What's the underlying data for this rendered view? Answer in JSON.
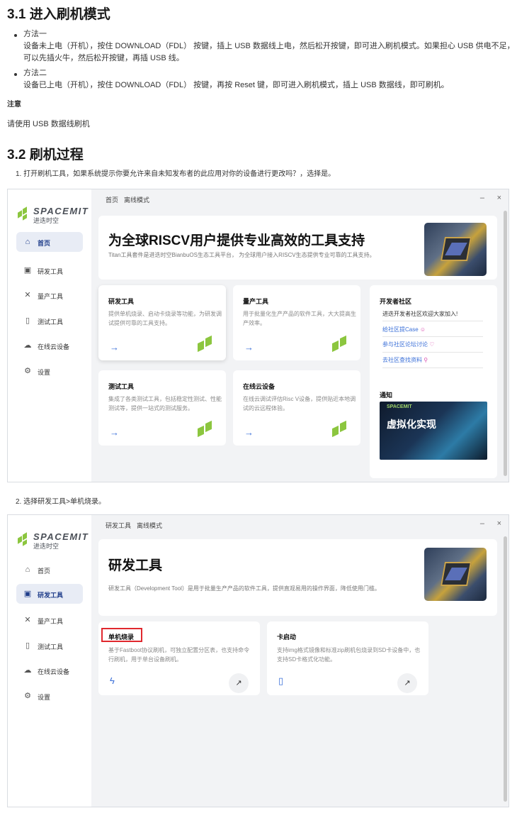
{
  "section1": {
    "heading": "3.1 进入刷机模式",
    "bullets": [
      {
        "title": "方法一",
        "lines": [
          "设备未上电（开机），按住 DOWNLOAD（FDL） 按键，插上 USB 数据线上电，然后松开按键，即可进入刷机模式。如果担心 USB 供电不足，",
          "可以先插火牛，然后松开按键，再插 USB 线。"
        ]
      },
      {
        "title": "方法二",
        "lines": [
          "设备已上电（开机），按住 DOWNLOAD（FDL） 按键，再按 Reset 键，即可进入刷机模式，插上 USB 数据线，即可刷机。"
        ]
      }
    ],
    "note_label": "注意",
    "note_text": "请使用 USB 数据线刷机"
  },
  "section2": {
    "heading": "3.2 刷机过程",
    "step1": "1. 打开刷机工具，如果系统提示你要允许来自未知发布者的此应用对你的设备进行更改吗？，选择是。",
    "step2": "2. 选择研发工具>单机烧录。"
  },
  "app": {
    "logo_text": "SPACEMIT",
    "logo_sub": "进迭时空",
    "nav": [
      {
        "label": "首页",
        "icon": "home-icon"
      },
      {
        "label": "研发工具",
        "icon": "dev-tool-icon"
      },
      {
        "label": "量产工具",
        "icon": "tools-icon"
      },
      {
        "label": "测试工具",
        "icon": "test-tube-icon"
      },
      {
        "label": "在线云设备",
        "icon": "cloud-icon"
      },
      {
        "label": "设置",
        "icon": "gear-icon"
      }
    ],
    "breadcrumb_home": "首页",
    "breadcrumb_dev": "研发工具",
    "breadcrumb_mode": "离线模式",
    "minimize": "–",
    "close": "×"
  },
  "shot1": {
    "banner_title": "为全球RISCV用户提供专业高效的工具支持",
    "banner_desc": "Titan工具套件是进迭时空BianbuOS生态工具平台， 为全球用户接入RISCV生态提供专业可靠的工具支持。",
    "cards": [
      {
        "title": "研发工具",
        "desc": "提供单机烧录、启动卡烧录等功能，为研发调试提供可靠的工具支持。"
      },
      {
        "title": "量产工具",
        "desc": "用于批量化生产产品的软件工具，大大提高生产效率。"
      },
      {
        "title": "测试工具",
        "desc": "集成了各类测试工具，包括稳定性测试、性能测试等，提供一站式的测试服务。"
      },
      {
        "title": "在线云设备",
        "desc": "在线云调试评估Risc V设备，提供贴近本地调试的云远程体验。"
      }
    ],
    "community": {
      "title": "开发者社区",
      "welcome": "进迭开发者社区欢迎大家加入!",
      "links": [
        "给社区提Case",
        "参与社区论坛讨论",
        "去社区查找资料"
      ],
      "notice_title": "通知",
      "notice_img_title": "虚拟化实现",
      "notice_img_brand": "SPACEMIT"
    }
  },
  "shot2": {
    "banner_title": "研发工具",
    "banner_desc": "研发工具（Development Tool）是用于批量生产产品的软件工具，提供直观易用的操作界面，降低使用门槛。",
    "cards": [
      {
        "title": "单机烧录",
        "desc": "基于Fastboot协议刷机，可独立配置分区表，也支持命令行刷机，用于单台设备刷机。"
      },
      {
        "title": "卡启动",
        "desc": "支持img格式镜像和标准zip刷机包烧录到SD卡设备中，也支持SD卡格式化功能。"
      }
    ]
  },
  "colors": {
    "accent": "#1f3d8a",
    "link": "#3a6fd8",
    "brand_green": "#8cc63f",
    "highlight_box": "#e0282e"
  }
}
